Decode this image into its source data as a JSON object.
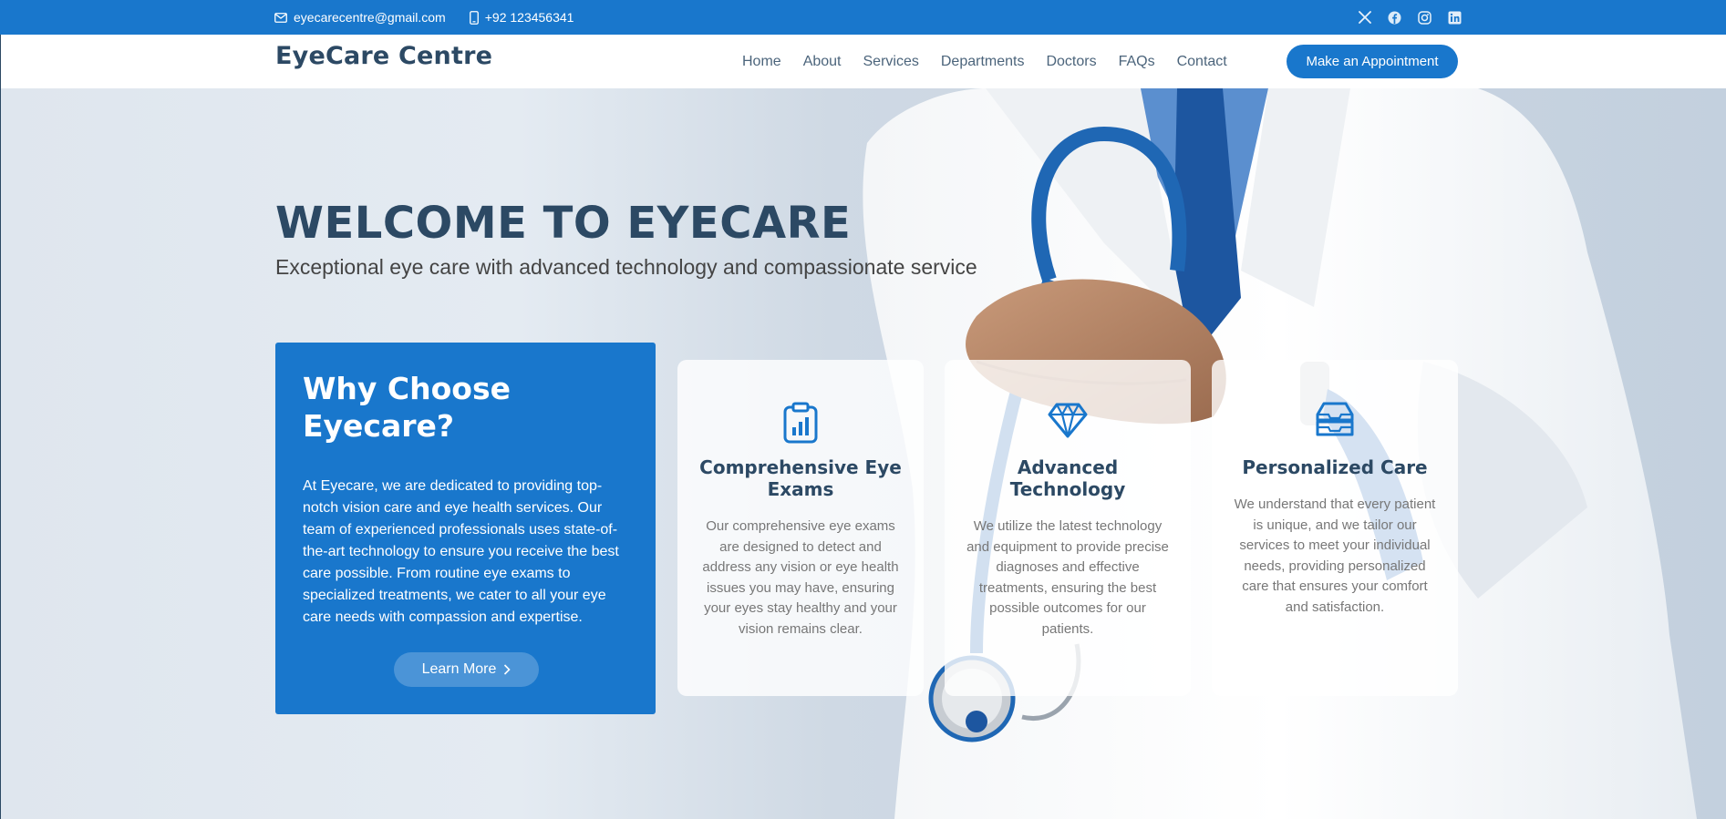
{
  "topbar": {
    "email": "eyecarecentre@gmail.com",
    "phone": "+92 123456341",
    "icons": [
      "envelope-icon",
      "phone-icon",
      "x-twitter-icon",
      "facebook-icon",
      "instagram-icon",
      "linkedin-icon"
    ]
  },
  "header": {
    "logo": "EyeCare Centre",
    "nav": [
      "Home",
      "About",
      "Services",
      "Departments",
      "Doctors",
      "FAQs",
      "Contact"
    ],
    "appointment_button": "Make an Appointment"
  },
  "hero": {
    "title": "WELCOME TO EYECARE",
    "subtitle": "Exceptional eye care with advanced technology and compassionate service"
  },
  "why": {
    "title": "Why Choose Eyecare?",
    "text": "At Eyecare, we are dedicated to providing top-notch vision care and eye health services. Our team of experienced professionals uses state-of-the-art technology to ensure you receive the best care possible. From routine eye exams to specialized treatments, we cater to all your eye care needs with compassion and expertise.",
    "button": "Learn More"
  },
  "cards": [
    {
      "icon": "clipboard-data-icon",
      "title": "Comprehensive Eye Exams",
      "text": "Our comprehensive eye exams are designed to detect and address any vision or eye health issues you may have, ensuring your eyes stay healthy and your vision remains clear."
    },
    {
      "icon": "gem-icon",
      "title": "Advanced Technology",
      "text": "We utilize the latest technology and equipment to provide precise diagnoses and effective treatments, ensuring the best possible outcomes for our patients."
    },
    {
      "icon": "inboxes-icon",
      "title": "Personalized Care",
      "text": "We understand that every patient is unique, and we tailor our services to meet your individual needs, providing personalized care that ensures your comfort and satisfaction."
    }
  ],
  "colors": {
    "primary": "#1977cc",
    "heading": "#2c4964",
    "text_muted": "#777777",
    "topbar_bg": "#1977cc"
  }
}
